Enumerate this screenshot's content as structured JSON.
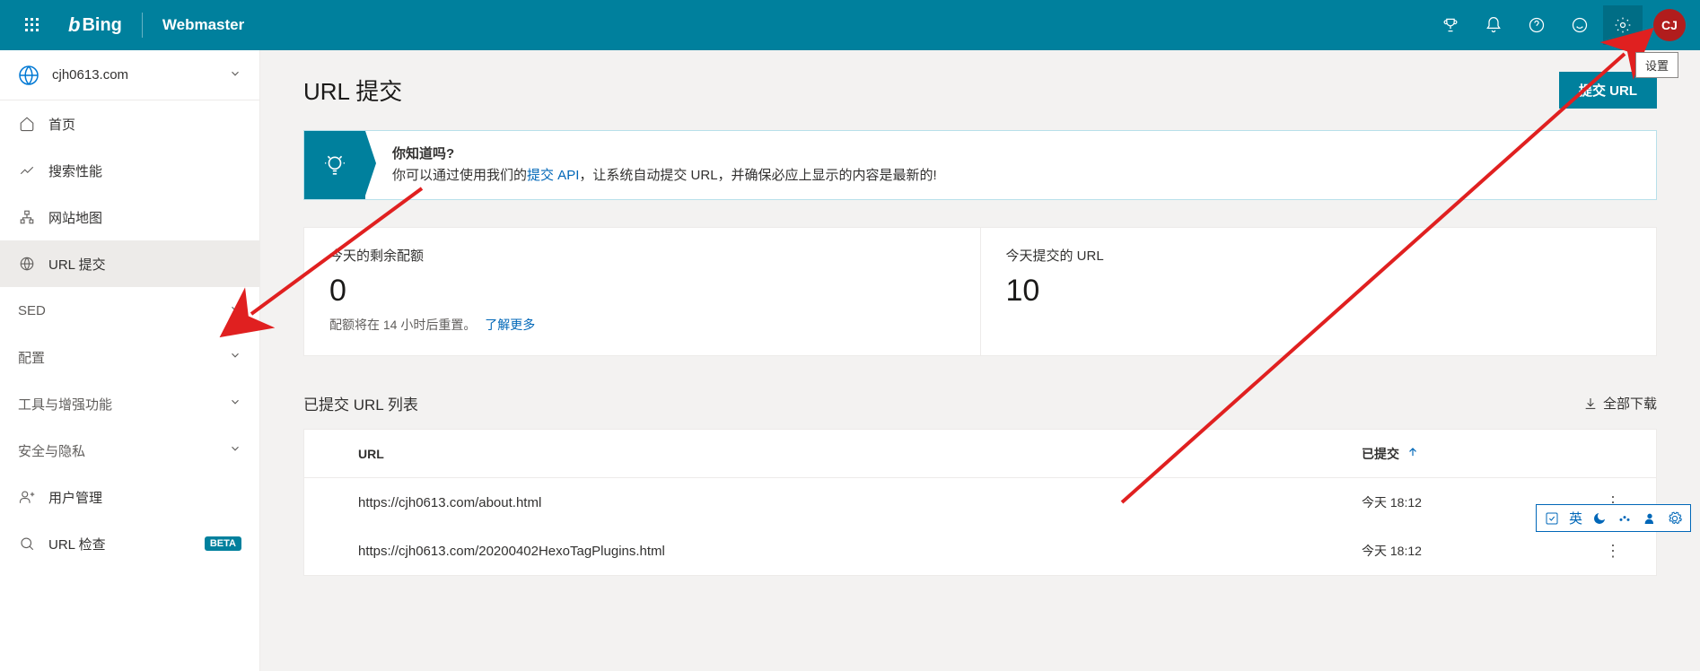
{
  "header": {
    "brand": "Bing",
    "product": "Webmaster",
    "avatar_initials": "CJ",
    "tooltip": "设置"
  },
  "sidebar": {
    "site_name": "cjh0613.com",
    "items": [
      {
        "label": "首页"
      },
      {
        "label": "搜索性能"
      },
      {
        "label": "网站地图"
      },
      {
        "label": "URL 提交"
      }
    ],
    "sections": [
      {
        "label": "SED"
      },
      {
        "label": "配置"
      },
      {
        "label": "工具与增强功能"
      },
      {
        "label": "安全与隐私"
      }
    ],
    "bottom_items": [
      {
        "label": "用户管理"
      },
      {
        "label": "URL 检查",
        "beta": "BETA"
      }
    ]
  },
  "page": {
    "title": "URL 提交",
    "submit_btn": "提交 URL",
    "tip_title": "你知道吗?",
    "tip_text_before": "你可以通过使用我们的",
    "tip_link": "提交 API",
    "tip_text_after": "，让系统自动提交 URL，并确保必应上显示的内容是最新的!",
    "stats": {
      "quota_label": "今天的剩余配额",
      "quota_value": "0",
      "quota_foot": "配额将在 14 小时后重置。",
      "learn_more": "了解更多",
      "submitted_label": "今天提交的 URL",
      "submitted_value": "10"
    },
    "list_title": "已提交 URL 列表",
    "download_all": "全部下载",
    "columns": {
      "url": "URL",
      "submitted": "已提交"
    },
    "rows": [
      {
        "url": "https://cjh0613.com/about.html",
        "time": "今天 18:12"
      },
      {
        "url": "https://cjh0613.com/20200402HexoTagPlugins.html",
        "time": "今天 18:12"
      }
    ]
  },
  "float_toolbar": {
    "text": "英"
  }
}
